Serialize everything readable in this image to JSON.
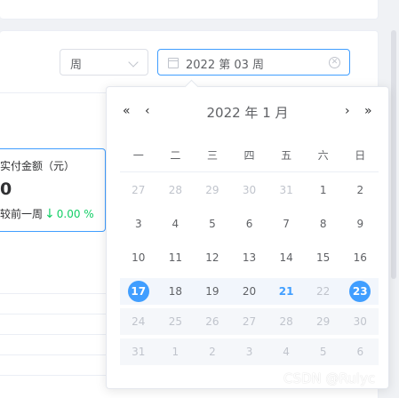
{
  "filter": {
    "period_value": "周",
    "date_value": "2022 第 03 周",
    "clear_icon": "circle-close-icon",
    "calendar_icon": "calendar-icon"
  },
  "metric": {
    "title": "实付金额（元）",
    "value": "0",
    "compare_label": "较前一周",
    "trend_icon": "arrow-down-icon",
    "trend_symbol": "↓",
    "trend_value": "0.00 %",
    "trend_color": "#13ce66"
  },
  "picker": {
    "title": "2022 年  1 月",
    "prev_year": "«",
    "prev_month": "‹",
    "next_month": "›",
    "next_year": "»",
    "weekdays": [
      "一",
      "二",
      "三",
      "四",
      "五",
      "六",
      "日"
    ],
    "weeks": [
      [
        "27",
        "28",
        "29",
        "30",
        "31",
        "1",
        "2"
      ],
      [
        "3",
        "4",
        "5",
        "6",
        "7",
        "8",
        "9"
      ],
      [
        "10",
        "11",
        "12",
        "13",
        "14",
        "15",
        "16"
      ],
      [
        "17",
        "18",
        "19",
        "20",
        "21",
        "22",
        "23"
      ],
      [
        "24",
        "25",
        "26",
        "27",
        "28",
        "29",
        "30"
      ],
      [
        "31",
        "1",
        "2",
        "3",
        "4",
        "5",
        "6"
      ]
    ],
    "accent_color": "#409eff"
  },
  "watermark": "CSDN @Rulyc"
}
